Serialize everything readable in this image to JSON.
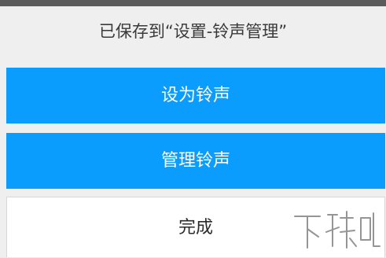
{
  "dialog": {
    "message": "已保存到“设置-铃声管理”",
    "set_ringtone_label": "设为铃声",
    "manage_ringtones_label": "管理铃声",
    "done_label": "完成"
  },
  "watermark": {
    "logo_text": "下载吧"
  },
  "colors": {
    "primary": "#0a9dfd",
    "background": "#efefef",
    "status_bar": "#5b5b5b"
  }
}
